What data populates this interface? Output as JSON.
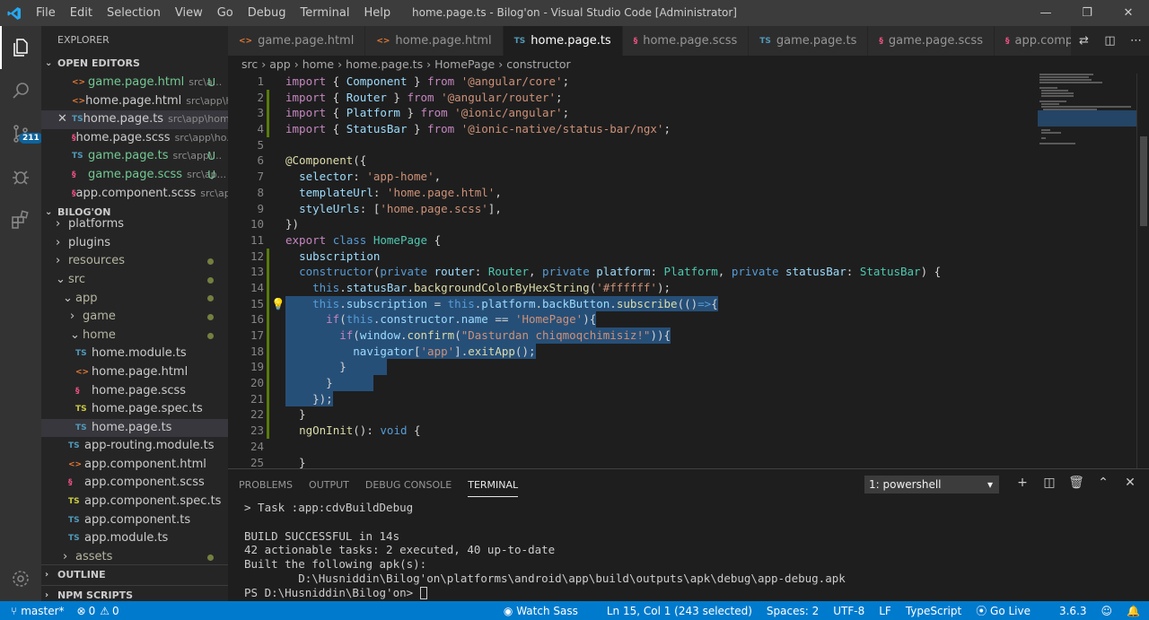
{
  "window": {
    "title": "home.page.ts - Bilog'on - Visual Studio Code [Administrator]",
    "menu": [
      "File",
      "Edit",
      "Selection",
      "View",
      "Go",
      "Debug",
      "Terminal",
      "Help"
    ]
  },
  "activity": {
    "scm_badge": "211"
  },
  "sidebar": {
    "title": "EXPLORER",
    "open_editors_label": "OPEN EDITORS",
    "open_editors": [
      {
        "name": "game.page.html",
        "desc": "src\\a...",
        "stat": "U",
        "type": "html"
      },
      {
        "name": "home.page.html",
        "desc": "src\\app\\ho...",
        "stat": "",
        "type": "html"
      },
      {
        "name": "home.page.ts",
        "desc": "src\\app\\home",
        "stat": "",
        "type": "ts"
      },
      {
        "name": "home.page.scss",
        "desc": "src\\app\\ho...",
        "stat": "",
        "type": "scss"
      },
      {
        "name": "game.page.ts",
        "desc": "src\\app\\...",
        "stat": "U",
        "type": "ts"
      },
      {
        "name": "game.page.scss",
        "desc": "src\\ap...",
        "stat": "U",
        "type": "scss"
      },
      {
        "name": "app.component.scss",
        "desc": "src\\app",
        "stat": "",
        "type": "scss"
      }
    ],
    "project_label": "BILOG'ON",
    "tree": [
      {
        "name": "platforms",
        "indent": 16,
        "chev": "›"
      },
      {
        "name": "plugins",
        "indent": 16,
        "chev": "›"
      },
      {
        "name": "resources",
        "indent": 16,
        "chev": "›",
        "dot": true
      },
      {
        "name": "src",
        "indent": 16,
        "chev": "⌄",
        "dot": true
      },
      {
        "name": "app",
        "indent": 24,
        "chev": "⌄",
        "dot": true
      },
      {
        "name": "game",
        "indent": 32,
        "chev": "›",
        "dot": true
      },
      {
        "name": "home",
        "indent": 32,
        "chev": "⌄",
        "dot": true
      },
      {
        "name": "home.module.ts",
        "indent": 38,
        "type": "ts"
      },
      {
        "name": "home.page.html",
        "indent": 38,
        "type": "html"
      },
      {
        "name": "home.page.scss",
        "indent": 38,
        "type": "scss"
      },
      {
        "name": "home.page.spec.ts",
        "indent": 38,
        "type": "tsy"
      },
      {
        "name": "home.page.ts",
        "indent": 38,
        "type": "ts",
        "selected": true
      },
      {
        "name": "app-routing.module.ts",
        "indent": 30,
        "type": "ts"
      },
      {
        "name": "app.component.html",
        "indent": 30,
        "type": "html"
      },
      {
        "name": "app.component.scss",
        "indent": 30,
        "type": "scss"
      },
      {
        "name": "app.component.spec.ts",
        "indent": 30,
        "type": "tsy"
      },
      {
        "name": "app.component.ts",
        "indent": 30,
        "type": "ts"
      },
      {
        "name": "app.module.ts",
        "indent": 30,
        "type": "ts"
      },
      {
        "name": "assets",
        "indent": 24,
        "chev": "›",
        "dot": true
      }
    ],
    "outline_label": "OUTLINE",
    "npm_label": "NPM SCRIPTS"
  },
  "tabs": [
    {
      "name": "game.page.html",
      "type": "html"
    },
    {
      "name": "home.page.html",
      "type": "html"
    },
    {
      "name": "home.page.ts",
      "type": "ts",
      "active": true
    },
    {
      "name": "home.page.scss",
      "type": "scss"
    },
    {
      "name": "game.page.ts",
      "type": "ts"
    },
    {
      "name": "game.page.scss",
      "type": "scss"
    },
    {
      "name": "app.compor",
      "type": "scss"
    }
  ],
  "breadcrumb": [
    "src",
    "app",
    "home",
    "home.page.ts",
    "HomePage",
    "constructor"
  ],
  "code_lines": [
    "1",
    "2",
    "3",
    "4",
    "5",
    "6",
    "7",
    "8",
    "9",
    "10",
    "11",
    "12",
    "13",
    "14",
    "15",
    "16",
    "17",
    "18",
    "19",
    "20",
    "21",
    "22",
    "23",
    "24",
    "25"
  ],
  "panel": {
    "tabs": [
      "PROBLEMS",
      "OUTPUT",
      "DEBUG CONSOLE",
      "TERMINAL"
    ],
    "terminal_select": "1: powershell",
    "lines": [
      "> Task :app:cdvBuildDebug",
      "",
      "BUILD SUCCESSFUL in 14s",
      "42 actionable tasks: 2 executed, 40 up-to-date",
      "Built the following apk(s):",
      "        D:\\Husniddin\\Bilog'on\\platforms\\android\\app\\build\\outputs\\apk\\debug\\app-debug.apk"
    ],
    "prompt": "PS D:\\Husniddin\\Bilog'on> "
  },
  "status": {
    "branch": "master*",
    "errors": "0",
    "warnings": "0",
    "watch_sass": "Watch Sass",
    "position": "Ln 15, Col 1 (243 selected)",
    "spaces": "Spaces: 2",
    "encoding": "UTF-8",
    "eol": "LF",
    "language": "TypeScript",
    "golive": "Go Live",
    "version": "3.6.3"
  }
}
